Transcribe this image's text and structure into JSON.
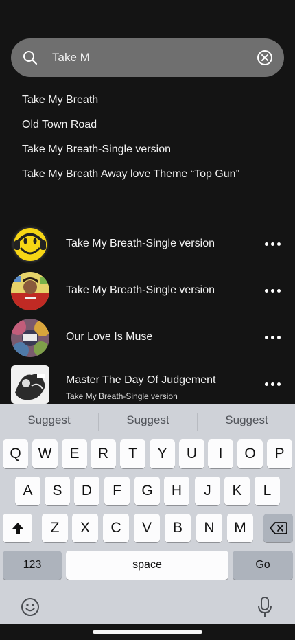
{
  "search": {
    "value": "Take M",
    "icon": "search-icon",
    "clear_icon": "clear-circle-x-icon"
  },
  "suggestions": [
    "Take My Breath",
    "Old Town Road",
    "Take My Breath-Single version",
    "Take My Breath Away love Theme “Top Gun”"
  ],
  "results": [
    {
      "title": "Take My Breath-Single version",
      "subtitle": "",
      "art": "yellow-smiley-headphones"
    },
    {
      "title": "Take My Breath-Single version",
      "subtitle": "",
      "art": "singer-red-jacket"
    },
    {
      "title": "Our Love Is Muse",
      "subtitle": "",
      "art": "muse-colorful-cover"
    },
    {
      "title": "Master The Day Of Judgement",
      "subtitle": "Take My Breath-Single version",
      "art": "black-white-sketch-cover"
    }
  ],
  "keyboard": {
    "suggestions": [
      "Suggest",
      "Suggest",
      "Suggest"
    ],
    "row1": [
      "Q",
      "W",
      "E",
      "R",
      "T",
      "Y",
      "U",
      "I",
      "O",
      "P"
    ],
    "row2": [
      "A",
      "S",
      "D",
      "F",
      "G",
      "H",
      "J",
      "K",
      "L"
    ],
    "row3": [
      "Z",
      "X",
      "C",
      "V",
      "B",
      "N",
      "M"
    ],
    "shift_icon": "shift-arrow-icon",
    "delete_icon": "backspace-icon",
    "numbers_label": "123",
    "space_label": "space",
    "go_label": "Go",
    "emoji_icon": "emoji-icon",
    "mic_icon": "microphone-icon"
  },
  "colors": {
    "background": "#141414",
    "search_bar": "#6f6f6f",
    "keyboard": "#cfd2d8"
  }
}
